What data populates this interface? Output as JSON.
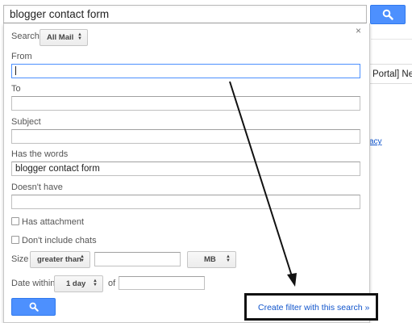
{
  "search_bar": {
    "query": "blogger contact form",
    "button_icon": "search-icon"
  },
  "background": {
    "row_text": "Portal] New",
    "link_text": "acy"
  },
  "panel": {
    "close_label": "×",
    "search_label": "Search",
    "search_scope": "All Mail",
    "from_label": "From",
    "from_value": "",
    "to_label": "To",
    "to_value": "",
    "subject_label": "Subject",
    "subject_value": "",
    "has_words_label": "Has the words",
    "has_words_value": "blogger contact form",
    "doesnt_have_label": "Doesn't have",
    "doesnt_have_value": "",
    "has_attachment_label": "Has attachment",
    "has_attachment_checked": false,
    "dont_include_chats_label": "Don't include chats",
    "dont_include_chats_checked": false,
    "size_label": "Size",
    "size_operator": "greater than",
    "size_value": "",
    "size_unit": "MB",
    "date_within_label": "Date within",
    "date_within_value": "1 day",
    "of_label": "of",
    "of_value": "",
    "submit_icon": "search-icon",
    "create_filter_link": "Create filter with this search »"
  },
  "colors": {
    "primary_blue": "#4d90fe",
    "link_blue": "#1155cc",
    "annotation_black": "#111111"
  }
}
